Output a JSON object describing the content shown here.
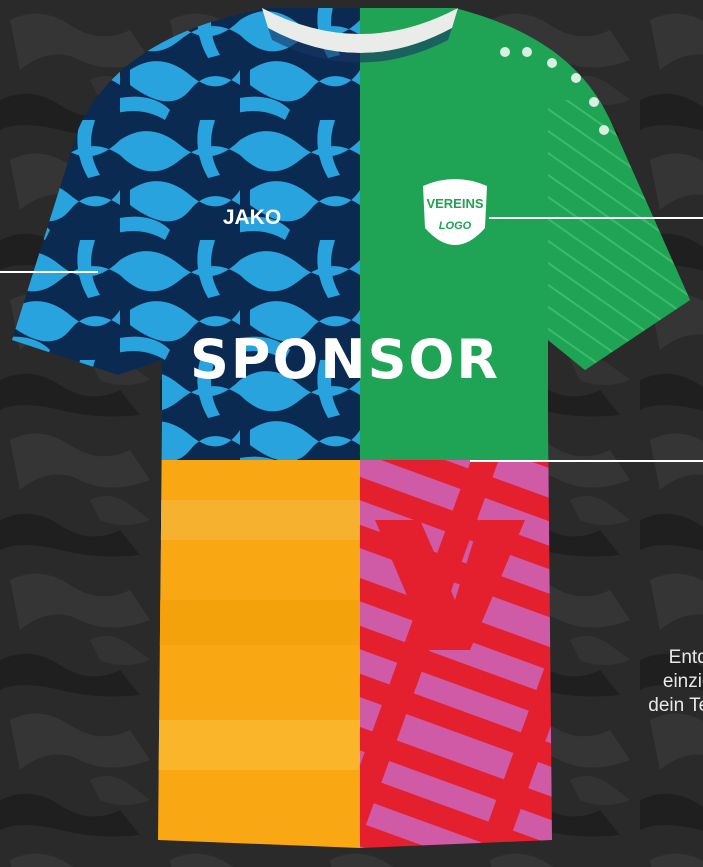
{
  "jersey": {
    "brand": "JAKO",
    "sponsor": "SPONSOR",
    "club_logo": {
      "line1": "VEREINS",
      "line2": "LOGO"
    },
    "colors": {
      "navy": "#0b2a52",
      "sky": "#29a3dd",
      "green": "#1fa354",
      "orange": "#f9a713",
      "red": "#e5202e",
      "pink": "#cf5aa6",
      "collar": "#e9ece8"
    }
  },
  "promo_text": {
    "line1": "Entdeck",
    "line2": "einziga",
    "line3": "dein Tea"
  }
}
